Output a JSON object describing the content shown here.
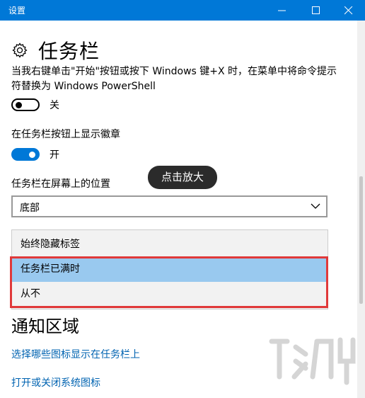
{
  "window": {
    "title": "设置"
  },
  "page": {
    "title": "任务栏"
  },
  "powershell": {
    "description": "当我右键单击\"开始\"按钮或按下 Windows 键+X 时，在菜单中将命令提示符替换为 Windows PowerShell",
    "state": "关"
  },
  "badges": {
    "label": "在任务栏按钮上显示徽章",
    "state": "开"
  },
  "position": {
    "label": "任务栏在屏幕上的位置",
    "value": "底部"
  },
  "tooltip": "点击放大",
  "combine": {
    "options": [
      "始终隐藏标签",
      "任务栏已满时",
      "从不"
    ],
    "selected_index": 1
  },
  "notification": {
    "title": "通知区域",
    "link1": "选择哪些图标显示在任务栏上",
    "link2": "打开或关闭系统图标"
  },
  "colors": {
    "accent": "#0078d7",
    "highlight_border": "#e0393a",
    "selected_bg": "#99c9ef"
  }
}
